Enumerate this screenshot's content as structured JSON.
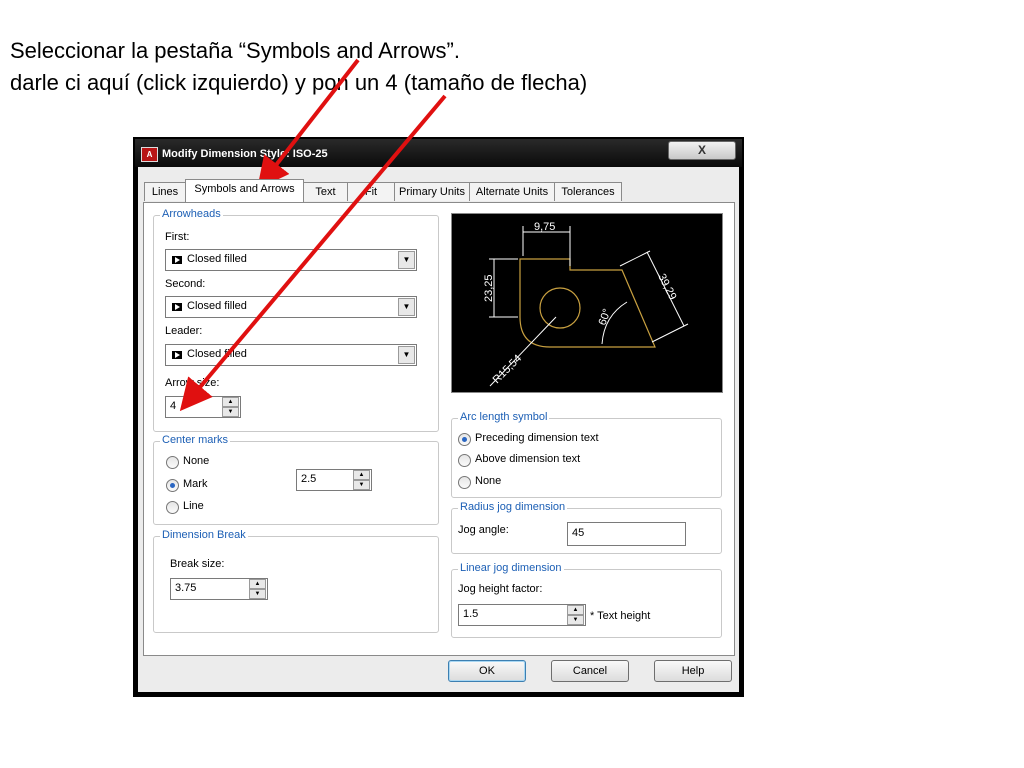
{
  "instructions": {
    "line1": "Seleccionar la pestaña “Symbols and Arrows”.",
    "line2": "darle ci aquí (click izquierdo) y pon un 4 (tamaño de flecha)"
  },
  "window": {
    "title": "Modify Dimension Style: ISO-25",
    "close_glyph": "X"
  },
  "tabs": [
    "Lines",
    "Symbols and Arrows",
    "Text",
    "Fit",
    "Primary Units",
    "Alternate Units",
    "Tolerances"
  ],
  "arrowheads": {
    "group_label": "Arrowheads",
    "first_label": "First:",
    "first_value": "Closed filled",
    "second_label": "Second:",
    "second_value": "Closed filled",
    "leader_label": "Leader:",
    "leader_value": "Closed filled",
    "arrow_size_label": "Arrow size:",
    "arrow_size_value": "4"
  },
  "center_marks": {
    "group_label": "Center marks",
    "options": [
      "None",
      "Mark",
      "Line"
    ],
    "selected": "Mark",
    "size_value": "2.5"
  },
  "dimension_break": {
    "group_label": "Dimension Break",
    "break_size_label": "Break size:",
    "break_size_value": "3.75"
  },
  "preview": {
    "dim_top": "9,75",
    "dim_left": "23,25",
    "dim_diag": "39,29",
    "angle": "60°",
    "radius": "R15,54"
  },
  "arc_length_symbol": {
    "group_label": "Arc length symbol",
    "options": [
      "Preceding dimension text",
      "Above dimension text",
      "None"
    ],
    "selected": "Preceding dimension text"
  },
  "radius_jog": {
    "group_label": "Radius jog dimension",
    "jog_angle_label": "Jog angle:",
    "jog_angle_value": "45"
  },
  "linear_jog": {
    "group_label": "Linear jog dimension",
    "height_factor_label": "Jog height factor:",
    "height_factor_value": "1.5",
    "suffix": "* Text height"
  },
  "buttons": {
    "ok": "OK",
    "cancel": "Cancel",
    "help": "Help"
  },
  "colors": {
    "annotation_arrow": "#e01010",
    "group_label": "#1c5fb5",
    "preview_line": "#c8a040"
  }
}
